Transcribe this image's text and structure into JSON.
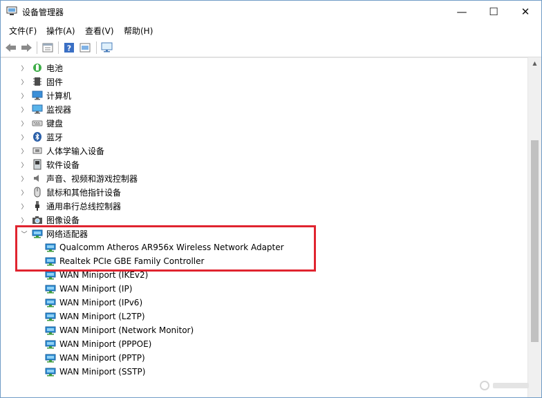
{
  "window": {
    "title": "设备管理器",
    "controls": {
      "minimize": "—",
      "maximize": "☐",
      "close": "✕"
    }
  },
  "menu": {
    "items": [
      {
        "label": "文件(F)",
        "name": "menu-file"
      },
      {
        "label": "操作(A)",
        "name": "menu-action"
      },
      {
        "label": "查看(V)",
        "name": "menu-view"
      },
      {
        "label": "帮助(H)",
        "name": "menu-help"
      }
    ]
  },
  "toolbar": {
    "buttons": [
      "back-icon",
      "forward-icon",
      "properties-icon",
      "help-icon",
      "update-icon",
      "monitor-scan-icon"
    ]
  },
  "tree": {
    "categories": [
      {
        "label": "电池",
        "icon": "battery-icon",
        "expanded": false
      },
      {
        "label": "固件",
        "icon": "firmware-icon",
        "expanded": false
      },
      {
        "label": "计算机",
        "icon": "computer-icon",
        "expanded": false
      },
      {
        "label": "监视器",
        "icon": "monitor-icon",
        "expanded": false
      },
      {
        "label": "键盘",
        "icon": "keyboard-icon",
        "expanded": false
      },
      {
        "label": "蓝牙",
        "icon": "bluetooth-icon",
        "expanded": false
      },
      {
        "label": "人体学输入设备",
        "icon": "hid-icon",
        "expanded": false
      },
      {
        "label": "软件设备",
        "icon": "software-device-icon",
        "expanded": false
      },
      {
        "label": "声音、视频和游戏控制器",
        "icon": "speaker-icon",
        "expanded": false
      },
      {
        "label": "鼠标和其他指针设备",
        "icon": "mouse-icon",
        "expanded": false
      },
      {
        "label": "通用串行总线控制器",
        "icon": "usb-icon",
        "expanded": false
      },
      {
        "label": "图像设备",
        "icon": "camera-icon",
        "expanded": false
      },
      {
        "label": "网络适配器",
        "icon": "network-adapter-icon",
        "expanded": true
      }
    ],
    "network_adapters": [
      "Qualcomm Atheros AR956x Wireless Network Adapter",
      "Realtek PCIe GBE Family Controller",
      "WAN Miniport (IKEv2)",
      "WAN Miniport (IP)",
      "WAN Miniport (IPv6)",
      "WAN Miniport (L2TP)",
      "WAN Miniport (Network Monitor)",
      "WAN Miniport (PPPOE)",
      "WAN Miniport (PPTP)",
      "WAN Miniport (SSTP)"
    ]
  },
  "colors": {
    "highlight_border": "#e0242f",
    "window_border": "#6f9bc6",
    "adapter_icon": "#2f8fd6"
  }
}
